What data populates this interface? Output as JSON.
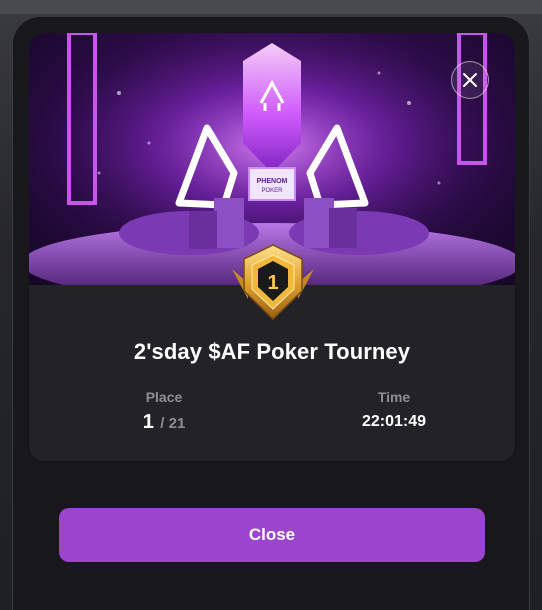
{
  "modal": {
    "close_icon": "close-icon",
    "banner": {
      "trophy_label_top": "PHENOM",
      "trophy_label_bottom": "POKER"
    },
    "rank_badge": {
      "value": "1"
    },
    "title": "2'sday $AF Poker Tourney",
    "place": {
      "label": "Place",
      "current": "1",
      "total": "/ 21"
    },
    "time": {
      "label": "Time",
      "value": "22:01:49"
    },
    "close_button_label": "Close"
  },
  "colors": {
    "accent": "#9b45cf",
    "modal_bg": "#18181c",
    "card_bg": "#232327",
    "muted_text": "#8d8d94",
    "badge_gold": "#e0a431"
  }
}
